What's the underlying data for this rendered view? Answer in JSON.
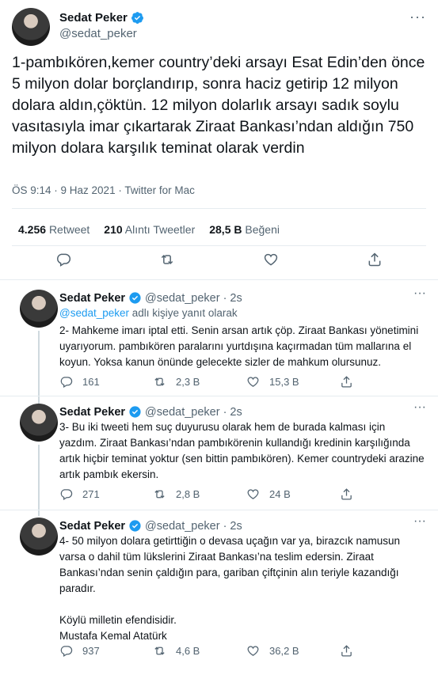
{
  "tweet": {
    "author_name": "Sedat Peker",
    "author_handle": "@sedat_peker",
    "text": "1-pambıkören,kemer country’deki arsayı Esat Edin’den önce 5 milyon dolar borçlandırıp, sonra haciz getirip 12 milyon dolara aldın,çöktün. 12 milyon dolarlık arsayı sadık soylu vasıtasıyla imar çıkartarak Ziraat Bankası’ndan aldığın 750 milyon dolara karşılık teminat olarak verdin",
    "meta": "ÖS 9:14 · 9 Haz 2021 · Twitter for Mac",
    "stats": {
      "retweets_value": "4.256",
      "retweets_label": "Retweet",
      "quotes_value": "210",
      "quotes_label": "Alıntı Tweetler",
      "likes_value": "28,5 B",
      "likes_label": "Beğeni"
    }
  },
  "replies": [
    {
      "author_name": "Sedat Peker",
      "author_handle": "@sedat_peker",
      "time": "2s",
      "reply_to_handle": "@sedat_peker",
      "reply_to_suffix": "adlı kişiye yanıt olarak",
      "text": "2- Mahkeme imarı iptal etti. Senin arsan artık çöp. Ziraat Bankası yönetimini uyarıyorum. pambıkören paralarını yurtdışına kaçırmadan tüm mallarına el koyun. Yoksa kanun önünde gelecekte sizler de mahkum olursunuz.",
      "replies": "161",
      "retweets": "2,3 B",
      "likes": "15,3 B"
    },
    {
      "author_name": "Sedat Peker",
      "author_handle": "@sedat_peker",
      "time": "2s",
      "text": "3- Bu iki tweeti hem suç duyurusu olarak hem de burada kalması için yazdım. Ziraat Bankası’ndan pambıkörenin kullandığı kredinin karşılığında artık hiçbir teminat yoktur (sen bittin pambıkören). Kemer countrydeki arazine artık pambık ekersin.",
      "replies": "271",
      "retweets": "2,8 B",
      "likes": "24 B"
    },
    {
      "author_name": "Sedat Peker",
      "author_handle": "@sedat_peker",
      "time": "2s",
      "text": "4- 50 milyon dolara getirttiğin o devasa uçağın var ya, birazcık namusun varsa o dahil tüm lükslerini Ziraat Bankası’na teslim edersin. Ziraat Bankası’ndan senin çaldığın para, gariban çiftçinin alın teriyle kazandığı paradır.\n\nKöylü milletin efendisidir.\nMustafa Kemal Atatürk",
      "replies": "937",
      "retweets": "4,6 B",
      "likes": "36,2 B"
    }
  ],
  "icons": {
    "verified": "verified-badge-icon",
    "more": "more-dots-icon",
    "reply": "reply-icon",
    "retweet": "retweet-icon",
    "like": "heart-icon",
    "share": "share-icon"
  },
  "colors": {
    "accent": "#1d9bf0",
    "muted": "#536471",
    "text": "#0f1419",
    "border": "#e6ecf0"
  }
}
